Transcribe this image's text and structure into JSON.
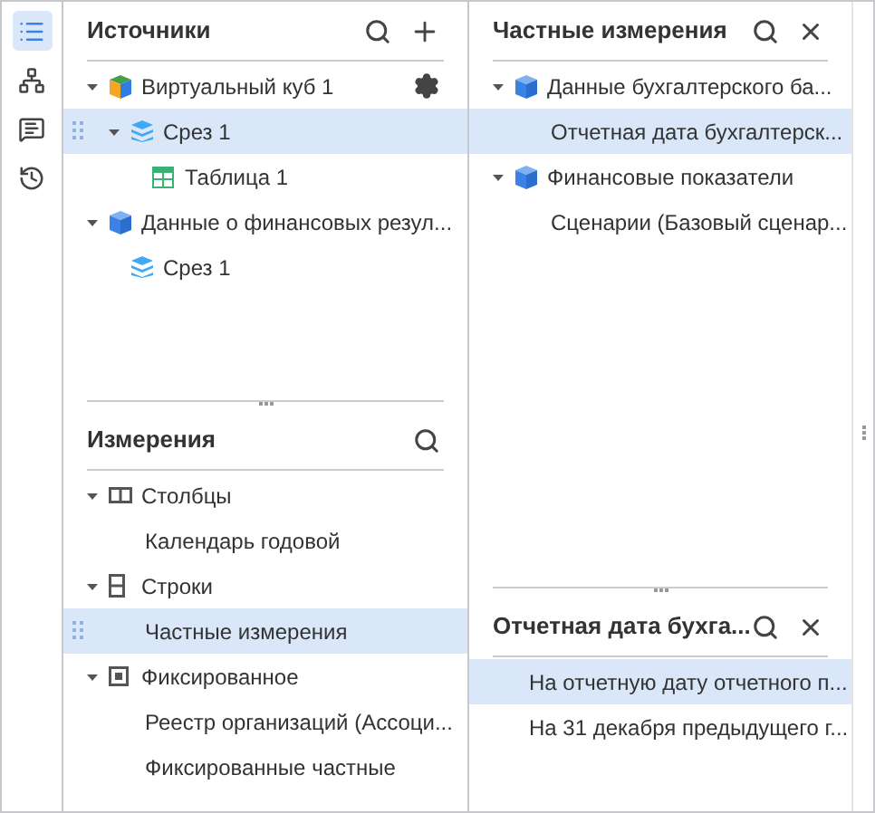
{
  "sidebar": {
    "items": [
      {
        "kind": "list",
        "selected": true
      },
      {
        "kind": "hierarchy",
        "selected": false
      },
      {
        "kind": "comment",
        "selected": false
      },
      {
        "kind": "history",
        "selected": false
      }
    ]
  },
  "sources": {
    "title": "Источники",
    "actions": [
      {
        "kind": "search"
      },
      {
        "kind": "add"
      }
    ],
    "drag_handles": true,
    "items": [
      {
        "label": "Виртуальный куб 1",
        "kind": "virtual-cube",
        "expanded": true,
        "selected": false,
        "settings": true,
        "children": [
          {
            "label": "Срез 1",
            "kind": "slice",
            "expanded": true,
            "selected": true,
            "children": [
              {
                "label": "Таблица 1",
                "kind": "table",
                "selected": false
              }
            ]
          }
        ]
      },
      {
        "label": "Данные о финансовых резул...",
        "kind": "cube",
        "expanded": true,
        "selected": false,
        "children": [
          {
            "label": "Срез 1",
            "kind": "slice",
            "selected": false
          }
        ]
      }
    ]
  },
  "dimensions": {
    "title": "Измерения",
    "actions": [
      {
        "kind": "search"
      }
    ],
    "drag_handles": true,
    "items": [
      {
        "label": "Столбцы",
        "kind": "columns",
        "expanded": true,
        "selected": false,
        "children": [
          {
            "label": "Календарь годовой",
            "selected": false
          }
        ]
      },
      {
        "label": "Строки",
        "kind": "rows",
        "expanded": true,
        "selected": false,
        "children": [
          {
            "label": "Частные измерения",
            "selected": true
          }
        ]
      },
      {
        "label": "Фиксированное",
        "kind": "fixed",
        "expanded": true,
        "selected": false,
        "children": [
          {
            "label": "Реестр организаций (Ассоци...",
            "selected": false
          },
          {
            "label": "Фиксированные частные",
            "selected": false
          }
        ]
      }
    ]
  },
  "private_dimensions": {
    "title": "Частные измерения",
    "actions": [
      {
        "kind": "search"
      },
      {
        "kind": "close"
      }
    ],
    "items": [
      {
        "label": "Данные бухгалтерского ба...",
        "kind": "cube",
        "expanded": true,
        "selected": false,
        "children": [
          {
            "label": "Отчетная дата бухгалтерск...",
            "selected": true
          }
        ]
      },
      {
        "label": "Финансовые показатели",
        "kind": "cube",
        "expanded": true,
        "selected": false,
        "children": [
          {
            "label": "Сценарии (Базовый сценар...",
            "selected": false
          }
        ]
      }
    ]
  },
  "elements": {
    "title": "Отчетная дата бухга...",
    "actions": [
      {
        "kind": "search"
      },
      {
        "kind": "close"
      }
    ],
    "items": [
      {
        "label": "На отчетную дату отчетного п...",
        "selected": true
      },
      {
        "label": "На 31 декабря предыдущего г...",
        "selected": false
      }
    ]
  }
}
